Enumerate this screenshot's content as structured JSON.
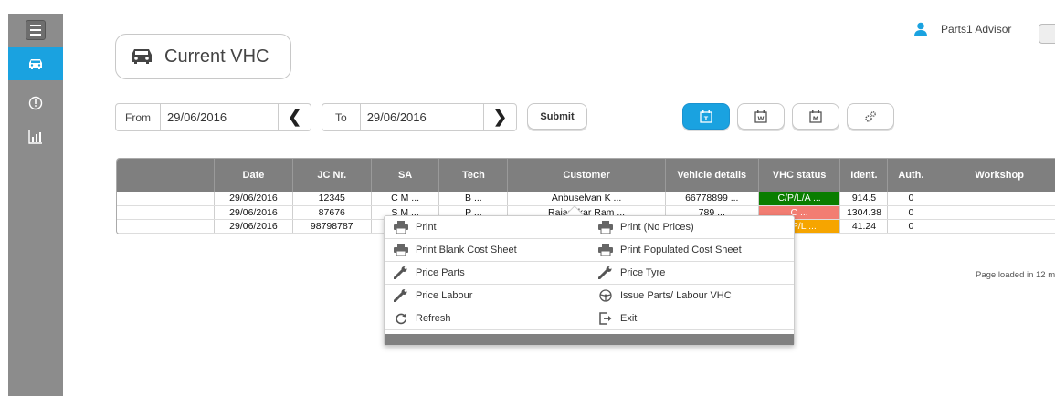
{
  "header": {
    "title": "Current VHC"
  },
  "user": {
    "name": "Parts1 Advisor"
  },
  "filters": {
    "from_label": "From",
    "from_value": "29/06/2016",
    "to_label": "To",
    "to_value": "29/06/2016",
    "submit_label": "Submit"
  },
  "table": {
    "columns": [
      "",
      "Date",
      "JC Nr.",
      "SA",
      "Tech",
      "Customer",
      "Vehicle details",
      "VHC status",
      "Ident.",
      "Auth.",
      "Workshop"
    ],
    "rows": [
      {
        "date": "29/06/2016",
        "jc": "12345",
        "sa": "C M ...",
        "tech": "B ...",
        "customer": "Anbuselvan K ...",
        "vehicle": "66778899 ...",
        "status": "C/P/L/A ...",
        "ident": "914.5",
        "auth": "0"
      },
      {
        "date": "29/06/2016",
        "jc": "87676",
        "sa": "S M ...",
        "tech": "P ...",
        "customer": "Rajashkar Ram ...",
        "vehicle": "789 ...",
        "status": "C ...",
        "ident": "1304.38",
        "auth": "0"
      },
      {
        "date": "29/06/2016",
        "jc": "98798787",
        "sa": "",
        "tech": "",
        "customer": "",
        "vehicle": "",
        "status": "C/P/L ...",
        "ident": "41.24",
        "auth": "0"
      }
    ]
  },
  "status_colors": {
    "green": "#0a7d00",
    "red": "#f27d72",
    "orange": "#f6a500"
  },
  "page_loaded": "Page loaded in 12 m",
  "context_menu": {
    "items": [
      {
        "label": "Print",
        "icon": "printer-icon"
      },
      {
        "label": "Print (No Prices)",
        "icon": "printer-icon"
      },
      {
        "label": "Print Blank Cost Sheet",
        "icon": "printer-icon"
      },
      {
        "label": "Print Populated Cost Sheet",
        "icon": "printer-icon"
      },
      {
        "label": "Price Parts",
        "icon": "wrench-icon"
      },
      {
        "label": "Price Tyre",
        "icon": "wrench-icon"
      },
      {
        "label": "Price Labour",
        "icon": "wrench-icon"
      },
      {
        "label": "Issue Parts/ Labour VHC",
        "icon": "steering-wheel-icon"
      },
      {
        "label": "Refresh",
        "icon": "refresh-icon"
      },
      {
        "label": "Exit",
        "icon": "exit-icon"
      }
    ]
  },
  "accent": "#1aa2e0"
}
